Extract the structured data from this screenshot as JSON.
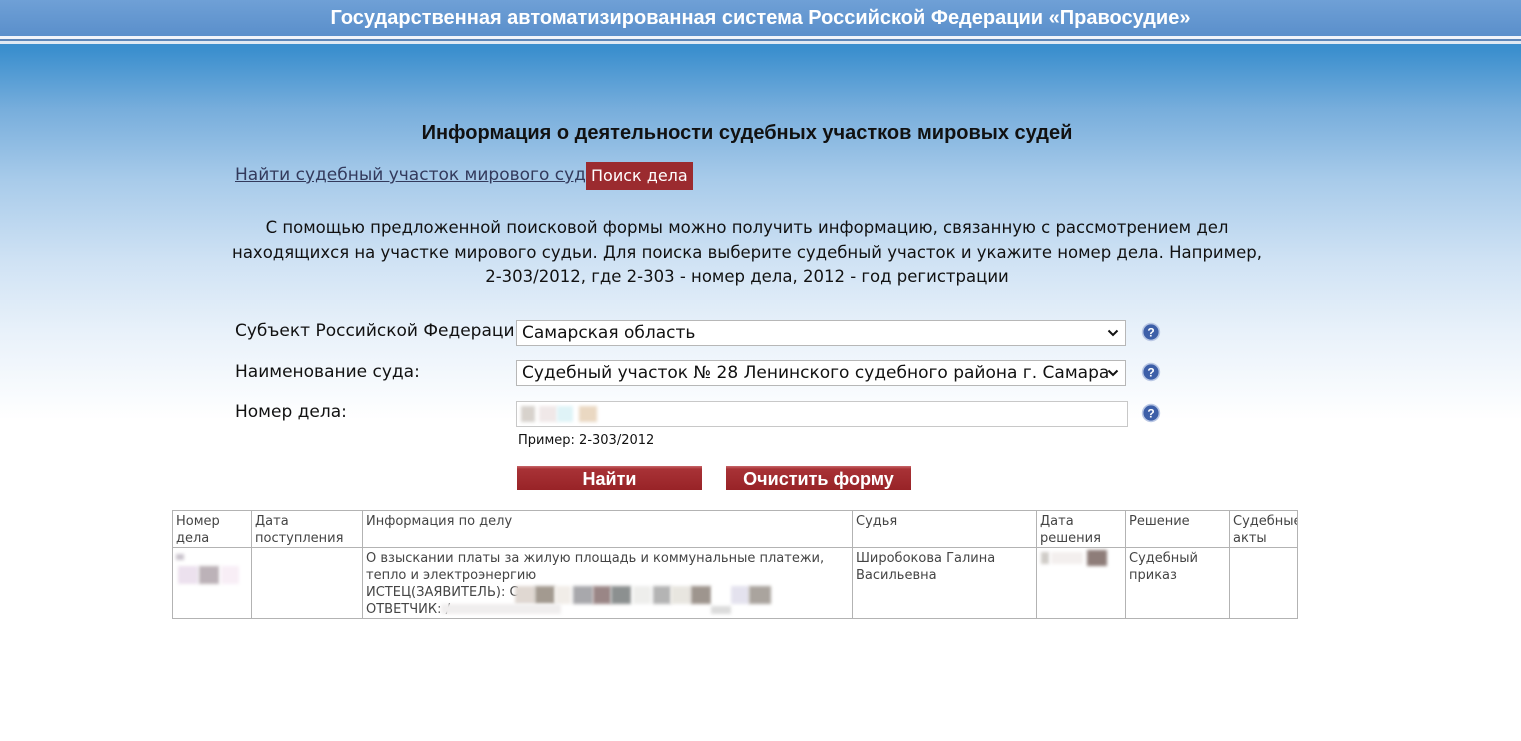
{
  "header": {
    "title": "Государственная автоматизированная система Российской Федерации «Правосудие»"
  },
  "page": {
    "title": "Информация о деятельности судебных участков мировых судей"
  },
  "nav": {
    "find_court_link": "Найти судебный участок мирового судьи",
    "case_search_tab": "Поиск дела"
  },
  "intro": {
    "text": "С помощью предложенной поисковой формы можно получить информацию, связанную с рассмотрением дел находящихся на участке мирового судьи. Для поиска выберите судебный участок и укажите номер дела. Например, 2-303/2012, где 2-303 - номер дела, 2012 - год регистрации"
  },
  "form": {
    "region": {
      "label": "Субъект Российской Федерации:",
      "value": "Самарская область"
    },
    "court": {
      "label": "Наименование суда:",
      "value": "Судебный участок № 28 Ленинского судебного района г. Самара"
    },
    "case_number": {
      "label": "Номер дела:",
      "example": "Пример: 2-303/2012"
    },
    "search_button": "Найти",
    "clear_button": "Очистить форму"
  },
  "results": {
    "columns": [
      "Номер дела",
      "Дата поступления",
      "Информация по делу",
      "Судья",
      "Дата решения",
      "Решение",
      "Судебные акты"
    ],
    "rows": [
      {
        "case_info_subject": "О взыскании платы за жилую площадь и коммунальные платежи, тепло и электроэнергию",
        "plaintiff_label": "ИСТЕЦ(ЗАЯВИТЕЛЬ): С",
        "defendant_label": "ОТВЕТЧИК: /",
        "judge": "Широбокова Галина Васильевна",
        "decision": "Судебный приказ"
      }
    ]
  },
  "icons": {
    "help": "help-question-icon",
    "dropdown": "chevron-down-icon"
  },
  "colors": {
    "accent_red": "#9b2b2f",
    "header_blue": "#5a8fcb",
    "help_icon_blue": "#3d5fa8"
  }
}
